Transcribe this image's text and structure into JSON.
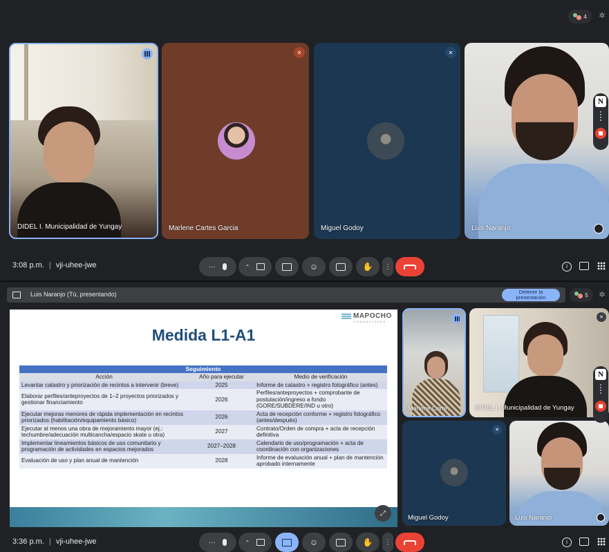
{
  "top_view": {
    "participant_count": "4",
    "time": "3:08 p.m.",
    "meeting_code": "vji-uhee-jwe",
    "tiles": [
      {
        "name": "DIDEL I. Municipalidad de Yungay"
      },
      {
        "name": "Marlene Cartes Garcia"
      },
      {
        "name": "Miguel Godoy"
      },
      {
        "name": "Luis Naranjo"
      }
    ]
  },
  "bottom_view": {
    "presenting_label": "Luis Naranjo (Tú, presentando)",
    "stop_button": "Detener la presentación",
    "participant_count": "5",
    "time": "3:36 p.m.",
    "meeting_code": "vji-uhee-jwe",
    "tiles": [
      {
        "name": "Marlene Carte..."
      },
      {
        "name": "DIDEL I. Municipalidad de Yungay"
      },
      {
        "name": "Miguel Godoy"
      },
      {
        "name": "Luis Naranjo"
      }
    ]
  },
  "slide": {
    "brand": "MAPOCHO",
    "brand_sub": "CONSULTORES",
    "title": "Medida L1-A1",
    "table_title": "Seguimiento",
    "headers": [
      "Acción",
      "Año para ejecutar",
      "Medio de verificación"
    ],
    "rows": [
      [
        "Levantar catastro y priorización de recintos a intervenir (breve)",
        "2025",
        "Informe de catastro + registro fotográfico (antes)"
      ],
      [
        "Elaborar perfiles/anteproyectos de 1–2 proyectos priorizados y gestionar financiamiento",
        "2026",
        "Perfiles/anteproyectos + comprobante de postulación/ingreso a fondo (GORE/SUBDERE/IND u otro)"
      ],
      [
        "Ejecutar mejoras menores de rápida implementación en recintos priorizados (habilitación/equipamiento básico)",
        "2026",
        "Acta de recepción conforme + registro fotográfico (antes/después)"
      ],
      [
        "Ejecutar al menos una obra de mejoramiento mayor (ej.: techumbre/adecuación multicancha/espacio skate u otra)",
        "2027",
        "Contrato/Orden de compra + acta de recepción definitiva"
      ],
      [
        "Implementar lineamientos básicos de uso comunitario y programación de actividades en espacios mejorados",
        "2027–2028",
        "Calendario de uso/programación + acta de coordinación con organizaciones"
      ],
      [
        "Evaluación de uso y plan anual de mantención",
        "2028",
        "Informe de evaluación anual + plan de mantención aprobado internamente"
      ]
    ]
  },
  "colors": {
    "end_call": "#ea4335",
    "present_active": "#8ab4f8",
    "speaking_border": "#8ab4f8",
    "table_header": "#4472c4",
    "title_blue": "#1f4e79"
  }
}
